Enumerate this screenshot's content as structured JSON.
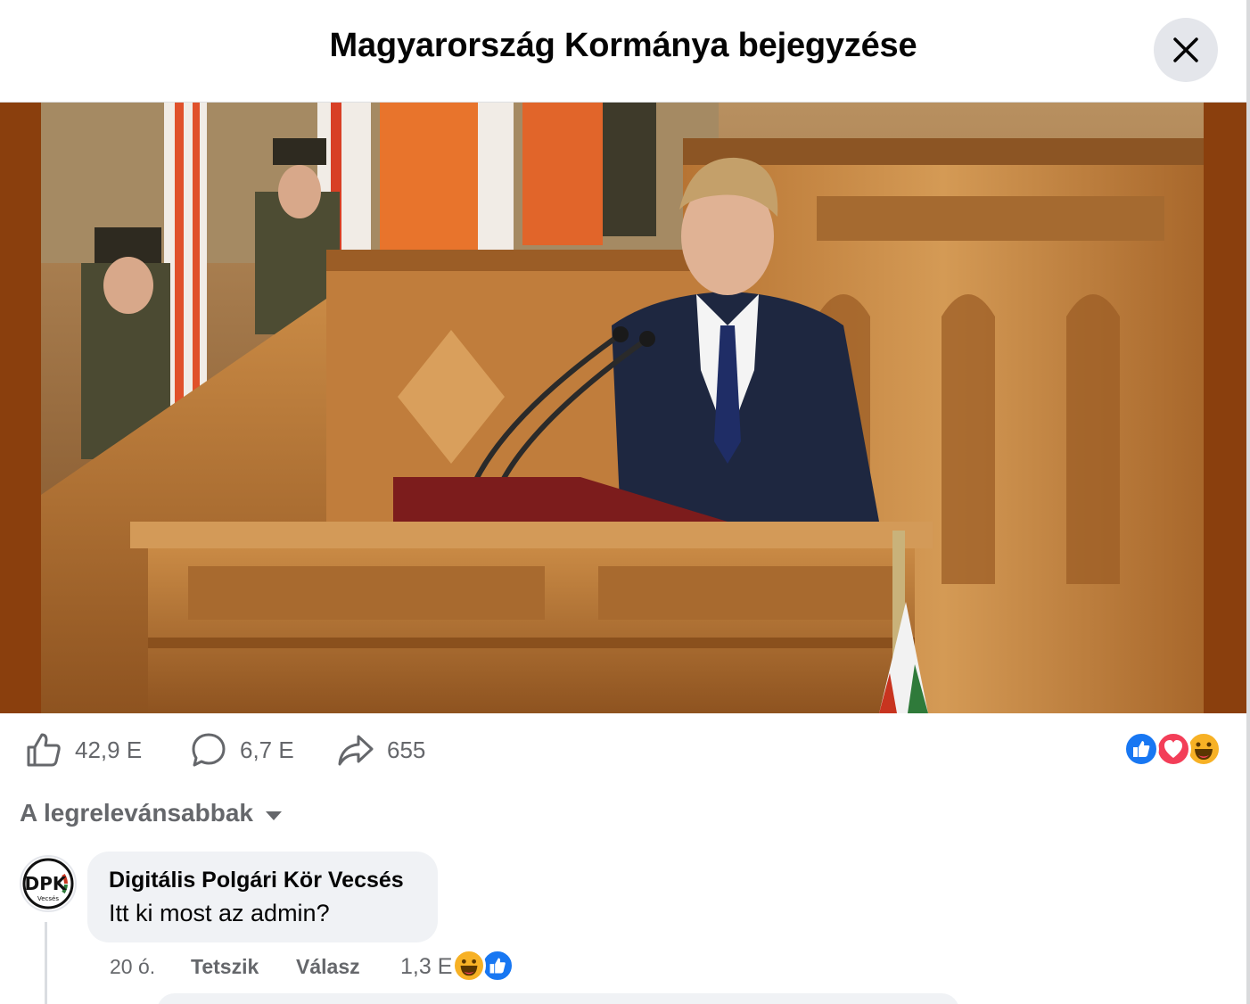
{
  "header": {
    "title": "Magyarország Kormánya bejegyzése",
    "close_icon": "close-icon"
  },
  "post": {
    "image": {
      "icon": "photo-speaker-at-podium"
    },
    "stats": {
      "likes": "42,9 E",
      "comments": "6,7 E",
      "shares": "655"
    },
    "reactions": [
      "like",
      "love",
      "haha"
    ],
    "colors": {
      "like": "#1877f2",
      "love": "#f33e58",
      "haha": "#f7b125",
      "muted_text": "#65676b"
    }
  },
  "comments": {
    "sort_label": "A legrelevánsabbak",
    "items": [
      {
        "author": "Digitális Polgári Kör Vecsés",
        "text": "Itt ki most az admin?",
        "time": "20 ó.",
        "like_label": "Tetszik",
        "reply_label": "Válasz",
        "reaction_count": "1,3 E",
        "reactions": [
          "haha",
          "like"
        ],
        "avatar": {
          "logo_text": "DPK",
          "logo_subtext": "Vecsés"
        }
      }
    ]
  }
}
